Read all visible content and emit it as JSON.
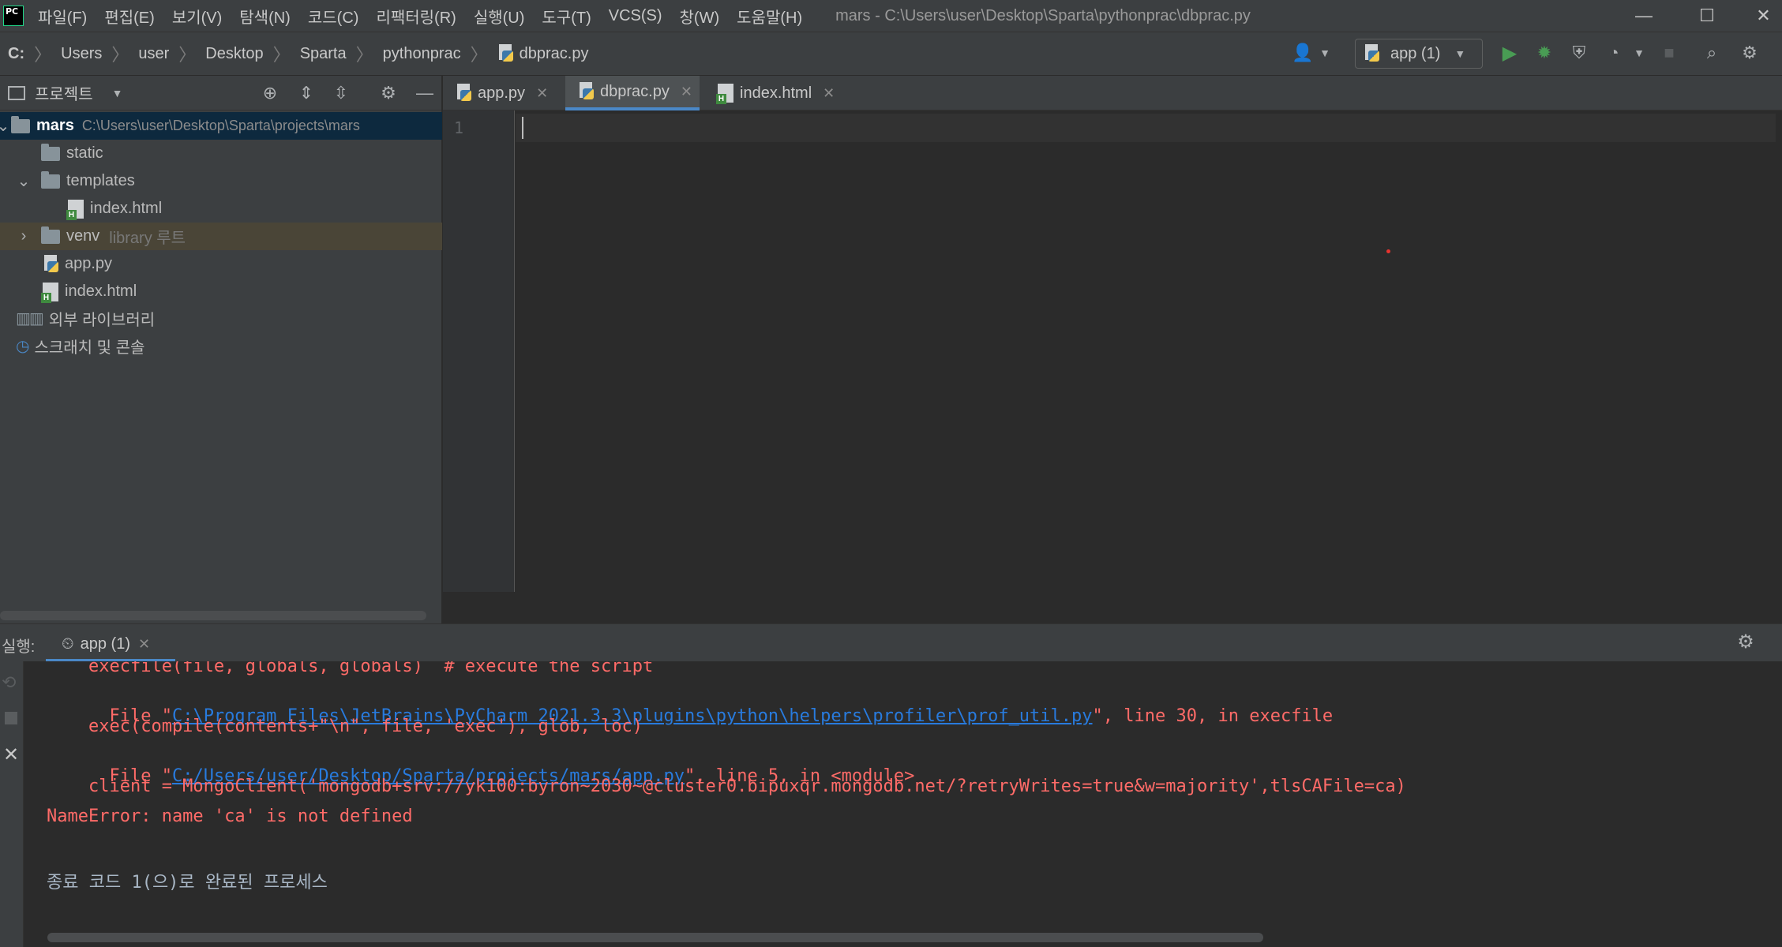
{
  "menubar": {
    "items": [
      "파일(F)",
      "편집(E)",
      "보기(V)",
      "탐색(N)",
      "코드(C)",
      "리팩터링(R)",
      "실행(U)",
      "도구(T)",
      "VCS(S)",
      "창(W)",
      "도움말(H)"
    ],
    "title": "mars - C:\\Users\\user\\Desktop\\Sparta\\pythonprac\\dbprac.py",
    "logo_text": "PC",
    "minimize": "—",
    "maximize": "☐",
    "close": "✕"
  },
  "navbar": {
    "breadcrumbs": [
      "C:",
      "Users",
      "user",
      "Desktop",
      "Sparta",
      "pythonprac",
      "dbprac.py"
    ],
    "run_config": "app (1)"
  },
  "project": {
    "title": "프로젝트",
    "tree": [
      {
        "name": "mars",
        "path": "C:\\Users\\user\\Desktop\\Sparta\\projects\\mars"
      },
      {
        "name": "static"
      },
      {
        "name": "templates"
      },
      {
        "name": "index.html"
      },
      {
        "name": "venv",
        "note": "library 루트"
      },
      {
        "name": "app.py"
      },
      {
        "name": "index.html"
      },
      {
        "name": "외부 라이브러리"
      },
      {
        "name": "스크래치 및 콘솔"
      }
    ]
  },
  "editor": {
    "tabs": [
      "app.py",
      "dbprac.py",
      "index.html"
    ],
    "active_tab": "dbprac.py",
    "line_numbers": [
      "1"
    ]
  },
  "run": {
    "label": "실행:",
    "tab": "app (1)",
    "console": {
      "line1": "    execfile(file, globals, globals)  # execute the script",
      "line2_prefix": "  File \"",
      "line2_link": "C:\\Program Files\\JetBrains\\PyCharm 2021.3.3\\plugins\\python\\helpers\\profiler\\prof_util.py",
      "line2_suffix": "\", line 30, in execfile",
      "line3": "    exec(compile(contents+\"\\n\", file, 'exec'), glob, loc)",
      "line4_prefix": "  File \"",
      "line4_link": "C:/Users/user/Desktop/Sparta/projects/mars/app.py",
      "line4_suffix": "\", line 5, in <module>",
      "line5": "    client = MongoClient('mongodb+srv://yk100:byron~2030~@cluster0.bipuxqr.mongodb.net/?retryWrites=true&w=majority',tlsCAFile=ca)",
      "line6": "NameError: name 'ca' is not defined",
      "line7": "종료 코드 1(으)로 완료된 프로세스"
    }
  },
  "colors": {
    "background": "#2b2b2b",
    "panel": "#3c3f41",
    "selection": "#0d293e",
    "accent": "#4a88c7",
    "error_text": "#ff6b68",
    "link": "#287bde",
    "run_green": "#499c54"
  }
}
